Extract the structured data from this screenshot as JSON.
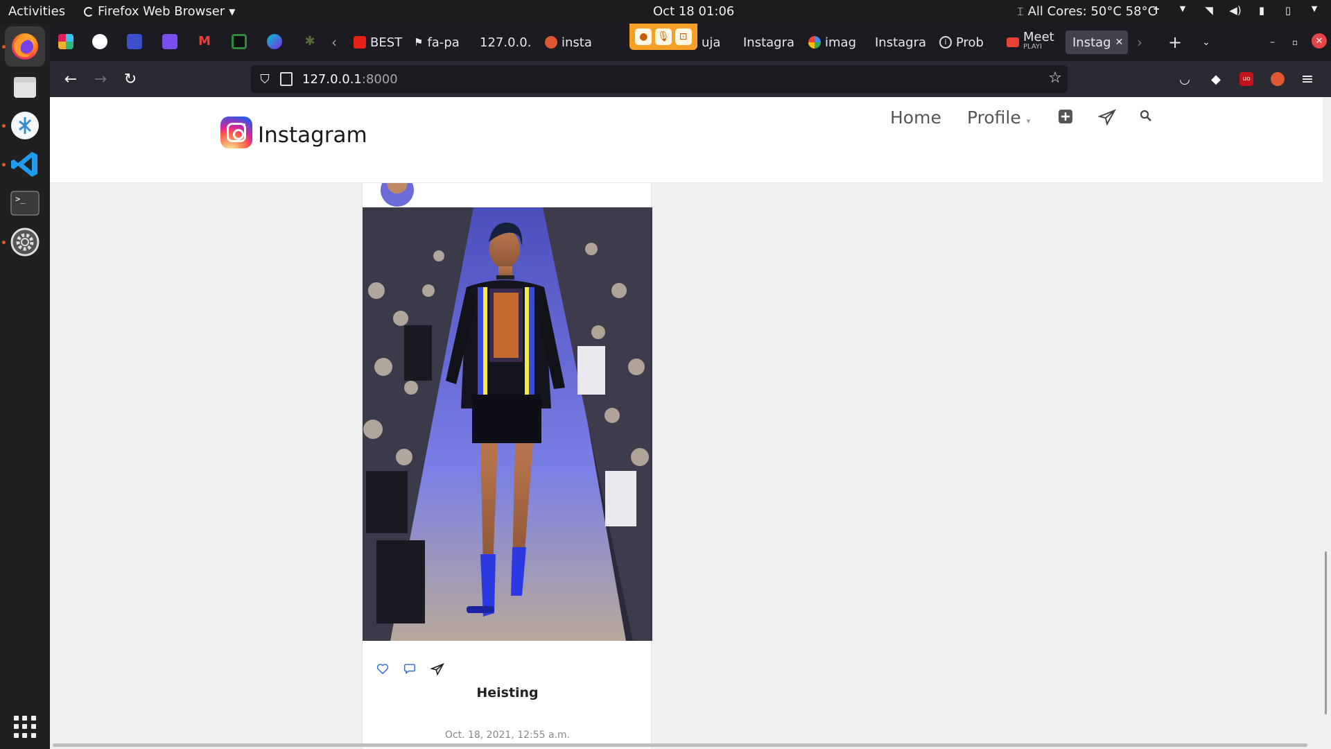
{
  "topbar": {
    "activities": "Activities",
    "app_name": "Firefox Web Browser",
    "clock": "Oct 18  01:06",
    "system_monitor": "All Cores: 50°C 58°C",
    "tray_icons": [
      "accessibility-icon",
      "network-wifi-icon",
      "volume-icon",
      "microphone-icon",
      "battery-icon",
      "system-menu-icon"
    ]
  },
  "dock": {
    "apps": [
      "firefox",
      "files",
      "remmina",
      "vscode",
      "terminal",
      "settings"
    ],
    "show_apps_icon": "grid-icon"
  },
  "browser": {
    "pinned_icons": [
      "slack-icon",
      "github-icon",
      "app-icon",
      "calendar-icon",
      "gmail-icon",
      "app-icon",
      "canva-icon",
      "palm-icon"
    ],
    "tabs": [
      {
        "label": "BEST",
        "icon": "youtube-icon",
        "active": false
      },
      {
        "label": "fa-pa",
        "icon": "flag-icon",
        "active": false
      },
      {
        "label": "127.0.0.",
        "icon": "",
        "active": false
      },
      {
        "label": "insta",
        "icon": "duckduckgo-icon",
        "active": false
      },
      {
        "label": "uja",
        "icon": "",
        "active": false
      },
      {
        "label": "Instagra",
        "icon": "",
        "active": false
      },
      {
        "label": "imag",
        "icon": "google-icon",
        "active": false
      },
      {
        "label": "Instagra",
        "icon": "",
        "active": false
      },
      {
        "label": "Prob",
        "icon": "info-icon",
        "active": false
      },
      {
        "label": "Meet",
        "sublabel": "PLAYI",
        "icon": "meet-icon",
        "active": false
      },
      {
        "label": "Instag",
        "icon": "",
        "active": true
      }
    ],
    "url_host": "127.0.0.1",
    "url_port": ":8000"
  },
  "site": {
    "brand": "Instagram",
    "nav": {
      "home": "Home",
      "profile": "Profile"
    },
    "post": {
      "caption": "Heisting",
      "timestamp": "Oct. 18, 2021, 12:55 a.m."
    }
  }
}
